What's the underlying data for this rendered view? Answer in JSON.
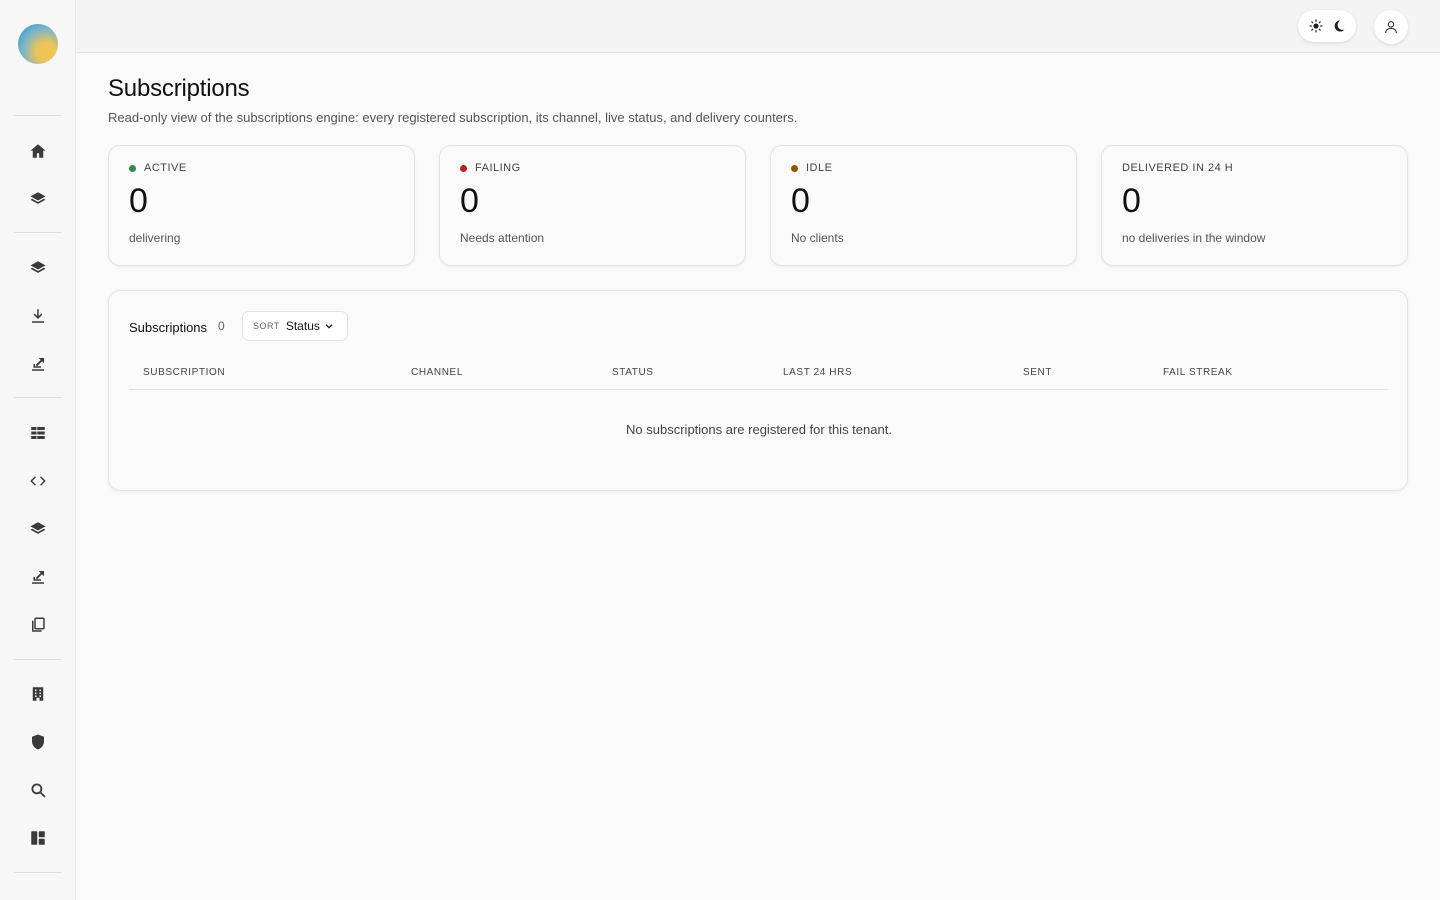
{
  "header": {
    "theme_light_icon": "sun-icon",
    "theme_dark_icon": "moon-icon",
    "user_icon": "user-icon"
  },
  "sidebar": {
    "items": [
      {
        "icon": "home-icon"
      },
      {
        "icon": "layers-icon"
      },
      {
        "icon": "layers-icon"
      },
      {
        "icon": "download-icon"
      },
      {
        "icon": "export-icon"
      },
      {
        "icon": "grid-icon"
      },
      {
        "icon": "code-icon"
      },
      {
        "icon": "layers-icon"
      },
      {
        "icon": "export-icon"
      },
      {
        "icon": "copy-icon"
      },
      {
        "icon": "building-icon"
      },
      {
        "icon": "shield-icon"
      },
      {
        "icon": "search-icon"
      },
      {
        "icon": "dashboard-icon"
      }
    ]
  },
  "page": {
    "title": "Subscriptions",
    "description": "Read-only view of the subscriptions engine: every registered subscription, its channel, live status, and delivery counters."
  },
  "stats": [
    {
      "label": "ACTIVE",
      "value": "0",
      "sub": "delivering",
      "dot_color": "#2e8b4a"
    },
    {
      "label": "FAILING",
      "value": "0",
      "sub": "Needs attention",
      "dot_color": "#b3261e"
    },
    {
      "label": "IDLE",
      "value": "0",
      "sub": "No clients",
      "dot_color": "#8a5a00"
    },
    {
      "label": "DELIVERED IN 24 H",
      "value": "0",
      "sub": "no deliveries in the window",
      "dot_color": ""
    }
  ],
  "table": {
    "title": "Subscriptions",
    "count": "0",
    "sort_label": "SORT",
    "sort_value": "Status",
    "columns": [
      "SUBSCRIPTION",
      "CHANNEL",
      "STATUS",
      "LAST 24 HRS",
      "SENT",
      "FAIL STREAK"
    ],
    "rows": [],
    "empty_message": "No subscriptions are registered for this tenant."
  }
}
